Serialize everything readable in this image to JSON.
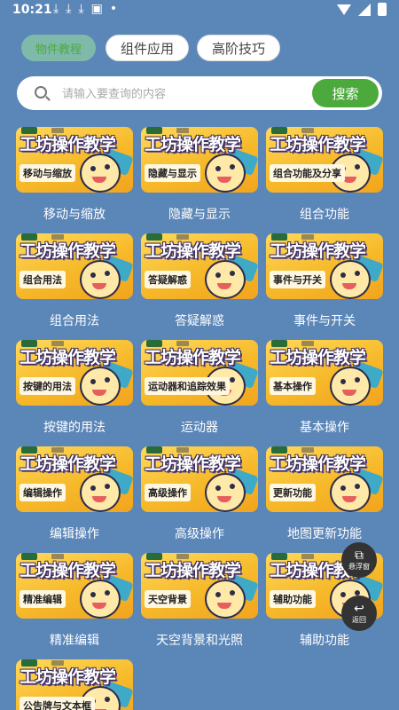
{
  "status": {
    "time": "10:21",
    "notif_icons": [
      "download-icon",
      "download-icon",
      "download-icon",
      "font-icon",
      "dot-icon"
    ]
  },
  "tabs": [
    "物件教程",
    "组件应用",
    "高阶技巧"
  ],
  "search": {
    "placeholder": "请输入要查询的内容",
    "button": "搜索"
  },
  "thumb_title": "工坊操作教学",
  "items": [
    {
      "thumb": "移动与缩放",
      "caption": "移动与缩放"
    },
    {
      "thumb": "隐藏与显示",
      "caption": "隐藏与显示"
    },
    {
      "thumb": "组合功能及分享",
      "caption": "组合功能"
    },
    {
      "thumb": "组合用法",
      "caption": "组合用法"
    },
    {
      "thumb": "答疑解惑",
      "caption": "答疑解惑"
    },
    {
      "thumb": "事件与开关",
      "caption": "事件与开关"
    },
    {
      "thumb": "按键的用法",
      "caption": "按键的用法"
    },
    {
      "thumb": "运动器和追踪效果",
      "caption": "运动器"
    },
    {
      "thumb": "基本操作",
      "caption": "基本操作"
    },
    {
      "thumb": "编辑操作",
      "caption": "编辑操作"
    },
    {
      "thumb": "高级操作",
      "caption": "高级操作"
    },
    {
      "thumb": "更新功能",
      "caption": "地图更新功能"
    },
    {
      "thumb": "精准编辑",
      "caption": "精准编辑"
    },
    {
      "thumb": "天空背景",
      "caption": "天空背景和光照"
    },
    {
      "thumb": "辅助功能",
      "caption": "辅助功能"
    },
    {
      "thumb": "公告牌与文本框",
      "caption": ""
    }
  ],
  "floating": {
    "window_label": "悬浮窗",
    "back_label": "返回"
  },
  "colors": {
    "background": "#5b86b8",
    "accent": "#4caa3c"
  }
}
